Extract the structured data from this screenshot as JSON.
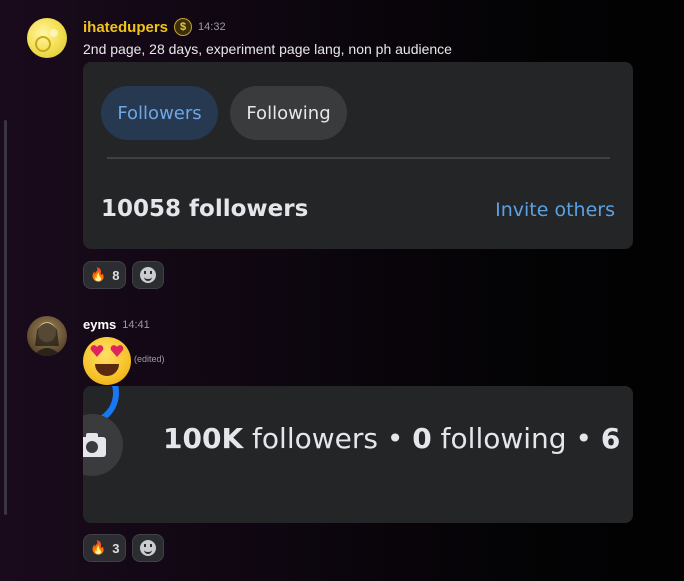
{
  "messages": [
    {
      "username": "ihatedupers",
      "badge": "$",
      "time": "14:32",
      "text": "2nd page, 28 days, experiment page lang, non ph audience",
      "card": {
        "tab_followers": "Followers",
        "tab_following": "Following",
        "count": "10058 followers",
        "invite": "Invite others"
      },
      "reaction": {
        "emoji": "🔥",
        "count": "8"
      }
    },
    {
      "username": "eyms",
      "time": "14:41",
      "edited": "(edited)",
      "card": {
        "followers_num": "100K",
        "followers_label": " followers",
        "sep1": "  •  ",
        "following_num": "0",
        "following_label": " following",
        "sep2": "  •  ",
        "cut": "6"
      },
      "reaction": {
        "emoji": "🔥",
        "count": "3"
      }
    }
  ],
  "colors": {
    "accent_blue": "#5aa1e6",
    "username_gold": "#f0c419",
    "card_bg": "#242526"
  }
}
